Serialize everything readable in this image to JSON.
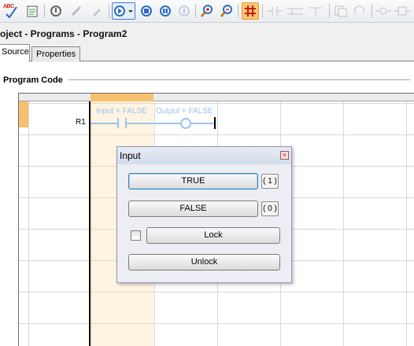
{
  "toolbar": {
    "buttons": [
      {
        "name": "spell-check-icon",
        "glyph": "ABC"
      },
      {
        "name": "watch-icon",
        "glyph": "✦"
      },
      {
        "name": "download-icon",
        "glyph": "⇩"
      },
      {
        "name": "online-icon",
        "glyph": "⟲"
      },
      {
        "name": "tools-icon",
        "glyph": "✎"
      },
      {
        "name": "brush-icon",
        "glyph": "⌁"
      },
      {
        "name": "run-icon",
        "glyph": "▶"
      },
      {
        "name": "stop-icon",
        "glyph": "■"
      },
      {
        "name": "pause-icon",
        "glyph": "❚❚"
      },
      {
        "name": "step-icon",
        "glyph": "▮"
      },
      {
        "name": "zoom-in-icon",
        "glyph": "+"
      },
      {
        "name": "zoom-out-icon",
        "glyph": "−"
      },
      {
        "name": "grid-icon",
        "glyph": "#"
      }
    ]
  },
  "document": {
    "title": "oject - Programs - Program2"
  },
  "tabs": [
    {
      "label": "Source",
      "selected": true
    },
    {
      "label": "Properties",
      "selected": false
    }
  ],
  "editor": {
    "group_label": "Program Code",
    "rung_label": "R1",
    "input_label": "Input = FALSE",
    "output_label": "Output = FALSE"
  },
  "dialog": {
    "title": "Input",
    "close_glyph": "×",
    "true_label": "TRUE",
    "true_key": "( 1 )",
    "false_label": "FALSE",
    "false_key": "( 0 )",
    "lock_label": "Lock",
    "unlock_label": "Unlock",
    "lock_checked": false
  },
  "colors": {
    "active_toolbar": "#ffc470",
    "selected_column": "#f6c16e",
    "inactive_wire": "#9dc3ea"
  }
}
